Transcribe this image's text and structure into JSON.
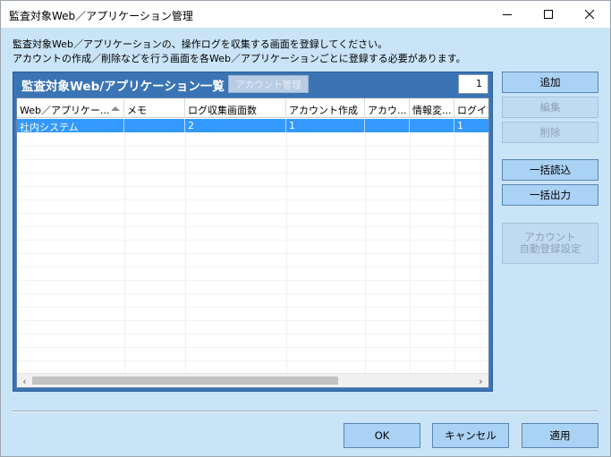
{
  "window": {
    "title": "監査対象Web／アプリケーション管理",
    "min_icon": "minimize-icon",
    "max_icon": "maximize-icon",
    "close_icon": "close-icon"
  },
  "description": {
    "line1": "監査対象Web／アプリケーションの、操作ログを収集する画面を登録してください。",
    "line2": "アカウントの作成／削除などを行う画面を各Web／アプリケーションごとに登録する必要があります。"
  },
  "panel": {
    "title": "監査対象Web/アプリケーション一覧",
    "account_button": "アカウント管理",
    "count": "1"
  },
  "table": {
    "columns": [
      "Web／アプリケー...",
      "メモ",
      "ログ収集画面数",
      "アカウント作成",
      "アカウ...",
      "情報変...",
      "ログイン"
    ],
    "rows": [
      [
        "社内システム",
        "",
        "2",
        "1",
        "",
        "",
        "1"
      ]
    ]
  },
  "side_buttons": {
    "add": "追加",
    "edit": "編集",
    "delete": "削除",
    "bulk_import": "一括読込",
    "bulk_export": "一括出力",
    "auto_register_line1": "アカウント",
    "auto_register_line2": "自動登録設定"
  },
  "bottom_buttons": {
    "ok": "OK",
    "cancel": "キャンセル",
    "apply": "適用"
  },
  "colors": {
    "background": "#c9e4f7",
    "panel": "#3a74b5",
    "selection": "#3399ff",
    "button": "#aad2f4"
  }
}
